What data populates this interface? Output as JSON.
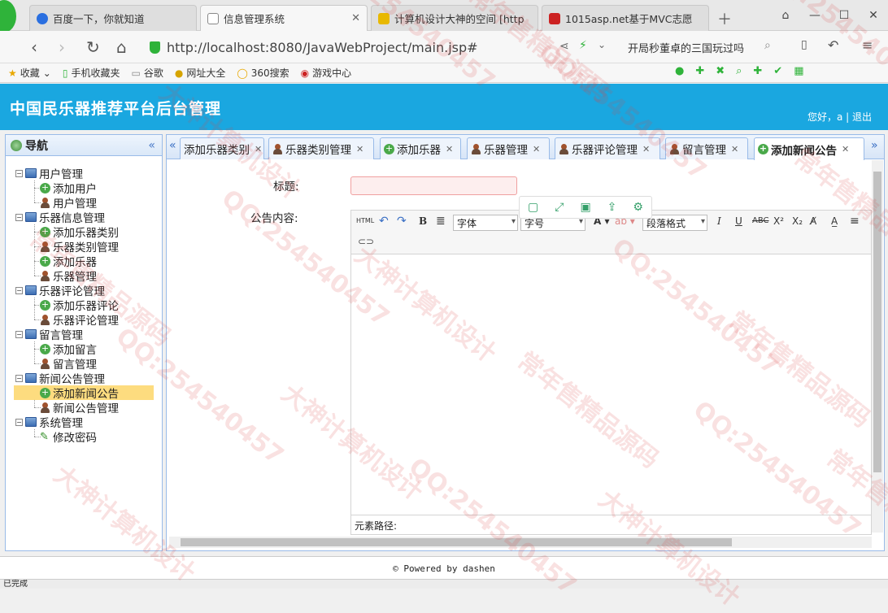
{
  "browser": {
    "tabs": [
      {
        "title": "百度一下，你就知道",
        "color": "#2a6fe0"
      },
      {
        "title": "信息管理系统",
        "color": "#777777"
      },
      {
        "title": "计算机设计大神的空间 [http",
        "color": "#e8b800"
      },
      {
        "title": "1015asp.net基于MVC志愿",
        "color": "#cc2222"
      }
    ],
    "url": "http://localhost:8080/JavaWebProject/main.jsp#",
    "search_suggestion": "开局秒董卓的三国玩过吗",
    "bookmarks": [
      "收藏",
      "手机收藏夹",
      "谷歌",
      "网址大全",
      "360搜索",
      "游戏中心"
    ]
  },
  "header": {
    "title": "中国民乐器推荐平台后台管理",
    "greeting": "您好，a",
    "logout": "退出"
  },
  "nav": {
    "title": "导航",
    "groups": [
      {
        "label": "用户管理",
        "items": [
          "添加用户",
          "用户管理"
        ]
      },
      {
        "label": "乐器信息管理",
        "items": [
          "添加乐器类别",
          "乐器类别管理",
          "添加乐器",
          "乐器管理"
        ]
      },
      {
        "label": "乐器评论管理",
        "items": [
          "添加乐器评论",
          "乐器评论管理"
        ]
      },
      {
        "label": "留言管理",
        "items": [
          "添加留言",
          "留言管理"
        ]
      },
      {
        "label": "新闻公告管理",
        "items": [
          "添加新闻公告",
          "新闻公告管理"
        ]
      },
      {
        "label": "系统管理",
        "items": [
          "修改密码"
        ]
      }
    ],
    "selected": "添加新闻公告"
  },
  "content_tabs": [
    "添加乐器类别",
    "乐器类别管理",
    "添加乐器",
    "乐器管理",
    "乐器评论管理",
    "留言管理",
    "添加新闻公告"
  ],
  "form": {
    "title_label": "标题:",
    "title_value": "",
    "content_label": "公告内容:"
  },
  "editor": {
    "html_btn": "HTML",
    "font_select": "字体",
    "size_select": "字号",
    "paragraph_select": "段落格式",
    "status_path": "元素路径:"
  },
  "footer": "© Powered by dashen",
  "statusbar": "已完成",
  "watermarks": [
    "QQ:254540457",
    "大神计算机设计",
    "常年售精品源码"
  ]
}
